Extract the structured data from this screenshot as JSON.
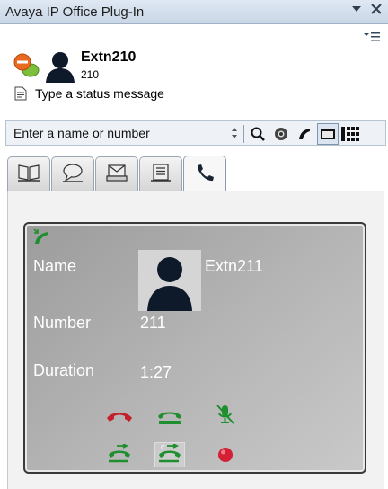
{
  "window": {
    "title": "Avaya IP Office Plug-In",
    "dropdown_icon": "chevron-down-icon",
    "close_icon": "close-icon",
    "menu_icon": "menu-icon"
  },
  "user": {
    "name": "Extn210",
    "extension": "210",
    "presence_icon": "presence-dnd-icon",
    "status_placeholder": "Type a status message"
  },
  "search": {
    "placeholder": "Enter a name or number",
    "buttons": [
      "search-icon",
      "camera-icon",
      "phone-icon",
      "window-icon",
      "dialpad-icon"
    ]
  },
  "tabs": [
    {
      "icon": "contacts-book-icon",
      "selected": false
    },
    {
      "icon": "chat-icon",
      "selected": false
    },
    {
      "icon": "voicemail-icon",
      "selected": false
    },
    {
      "icon": "call-log-icon",
      "selected": false
    },
    {
      "icon": "phone-icon",
      "selected": true
    }
  ],
  "call": {
    "state_icon": "incoming-call-icon",
    "name_label": "Name",
    "name_value": "Extn211",
    "number_label": "Number",
    "number_value": "211",
    "duration_label": "Duration",
    "duration_value": "1:27",
    "controls": [
      {
        "name": "hangup-icon",
        "color": "#c4202b"
      },
      {
        "name": "hold-icon",
        "color": "#1f8e2e"
      },
      {
        "name": "mute-icon",
        "color": "#1f8e2e"
      },
      {
        "name": "transfer-icon",
        "color": "#1f8e2e"
      },
      {
        "name": "consult-transfer-icon",
        "color": "#1f8e2e"
      },
      {
        "name": "record-icon",
        "color": "#d41f35"
      }
    ]
  }
}
